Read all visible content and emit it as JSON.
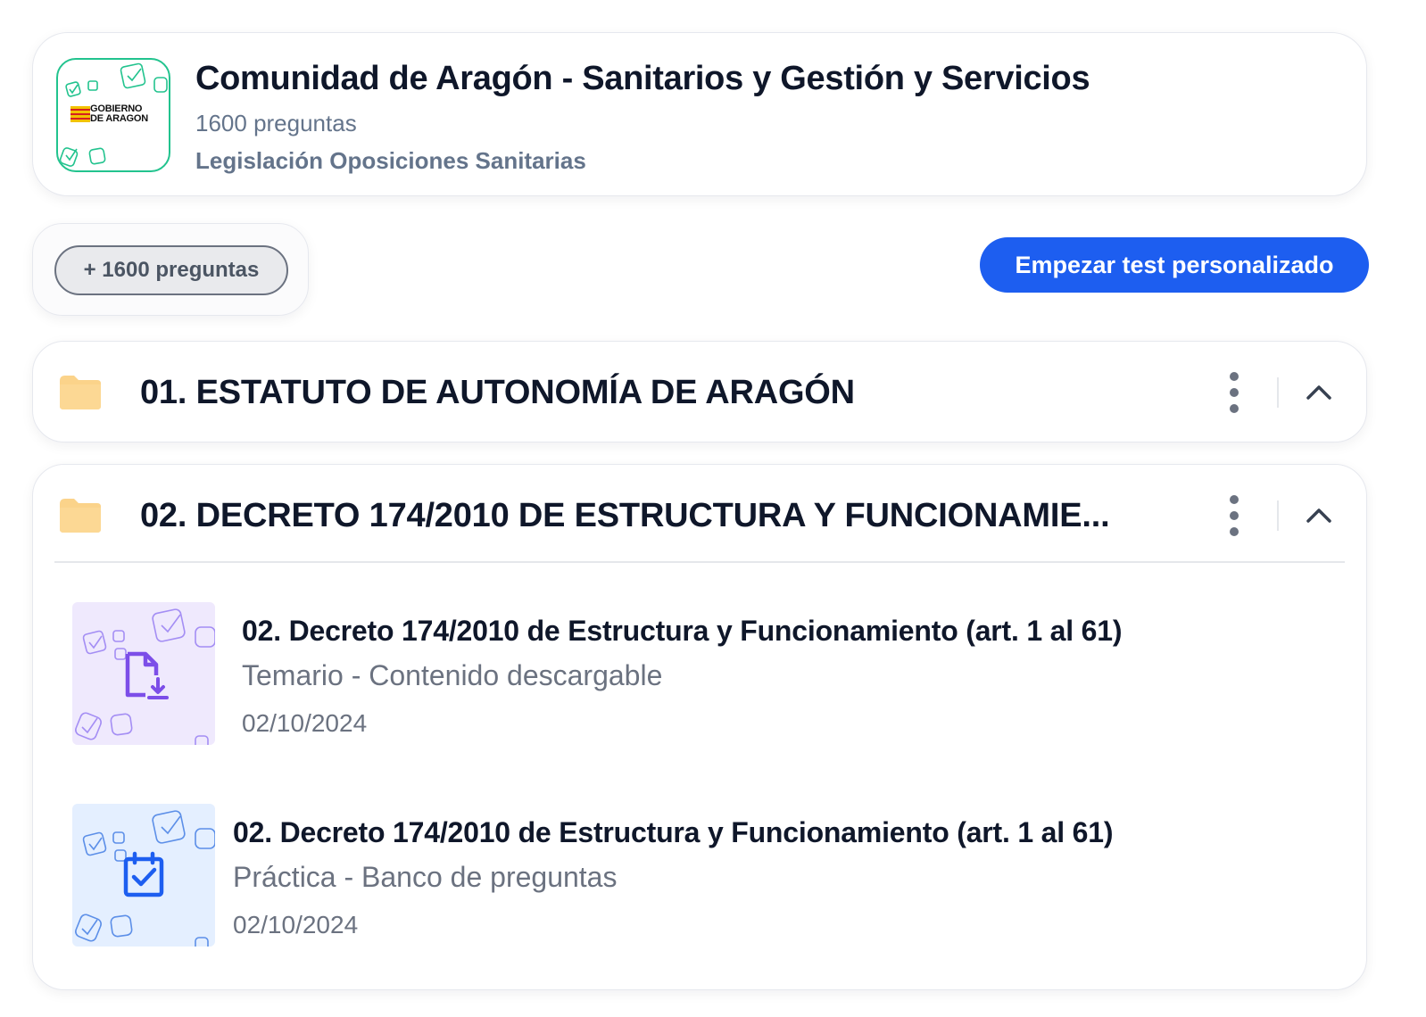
{
  "course": {
    "title": "Comunidad de Aragón - Sanitarios y Gestión y Servicios",
    "questions_count": "1600 preguntas",
    "category": "Legislación Oposiciones Sanitarias",
    "logo_text_line1": "GOBIERNO",
    "logo_text_line2": "DE ARAGON",
    "logo_border_color": "#22c38e"
  },
  "filters": {
    "questions_chip": "+ 1600 preguntas"
  },
  "actions": {
    "start_test_label": "Empezar test personalizado",
    "accent_color": "#1d5ef0"
  },
  "sections": [
    {
      "title": "01. ESTATUTO DE AUTONOMÍA DE ARAGÓN",
      "icon": "folder-icon",
      "expanded": false
    },
    {
      "title": "02. DECRETO 174/2010 DE ESTRUCTURA Y FUNCIONAMIE...",
      "icon": "folder-icon",
      "expanded": true,
      "items": [
        {
          "title": "02. Decreto 174/2010 de Estructura y Funcionamiento (art. 1 al 61)",
          "subtitle": "Temario - Contenido descargable",
          "date": "02/10/2024",
          "icon": "file-download-icon",
          "thumb_color": "#efe9fd"
        },
        {
          "title": "02. Decreto 174/2010 de Estructura y Funcionamiento (art. 1 al 61)",
          "subtitle": "Práctica - Banco de preguntas",
          "date": "02/10/2024",
          "icon": "clipboard-check-icon",
          "thumb_color": "#e4efff"
        }
      ]
    }
  ]
}
